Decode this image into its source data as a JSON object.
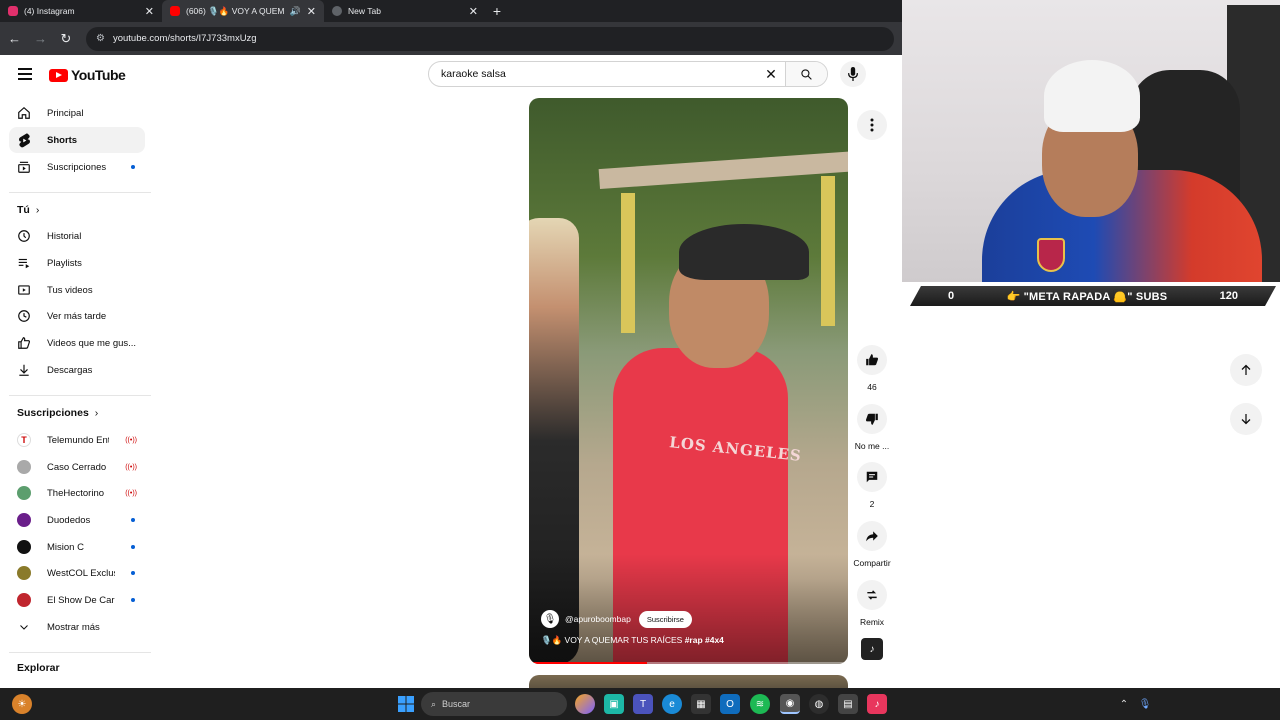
{
  "browser": {
    "tabs": [
      {
        "label": "(4) Instagram",
        "color": "#e1306c",
        "active": false
      },
      {
        "label": "(606) 🎙️🔥 VOY A QUEMAR",
        "color": "#ff0000",
        "active": true
      },
      {
        "label": "New Tab",
        "color": "#9aa0a6",
        "active": false
      }
    ],
    "url": "youtube.com/shorts/I7J733mxUzg"
  },
  "header": {
    "logo_text": "YouTube",
    "search_value": "karaoke salsa"
  },
  "sidebar": {
    "main": [
      {
        "label": "Principal",
        "icon": "home-icon"
      },
      {
        "label": "Shorts",
        "icon": "shorts-icon",
        "active": true
      },
      {
        "label": "Suscripciones",
        "icon": "subscriptions-icon",
        "dot": true
      }
    ],
    "you_heading": "Tú",
    "you": [
      {
        "label": "Historial",
        "icon": "history-icon"
      },
      {
        "label": "Playlists",
        "icon": "playlists-icon"
      },
      {
        "label": "Tus videos",
        "icon": "your-videos-icon"
      },
      {
        "label": "Ver más tarde",
        "icon": "watch-later-icon"
      },
      {
        "label": "Videos que me gus...",
        "icon": "liked-icon"
      },
      {
        "label": "Descargas",
        "icon": "download-icon"
      }
    ],
    "subs_heading": "Suscripciones",
    "subs": [
      {
        "label": "Telemundo Entre...",
        "color": "#ffffff",
        "live": true
      },
      {
        "label": "Caso Cerrado",
        "color": "#a9a9a9",
        "live": true
      },
      {
        "label": "TheHectorino",
        "color": "#5c9e6e",
        "live": true
      },
      {
        "label": "Duodedos",
        "color": "#6a1e8a",
        "live": false
      },
      {
        "label": "Mision C",
        "color": "#111111",
        "live": false
      },
      {
        "label": "WestCOL Exclusi...",
        "color": "#8a7a2a",
        "live": false
      },
      {
        "label": "El Show De Carlo...",
        "color": "#c0262e",
        "live": false
      }
    ],
    "show_more": "Mostrar más",
    "explore_heading": "Explorar"
  },
  "short": {
    "channel": "@apuroboombap",
    "subscribe": "Suscribirse",
    "title_prefix": "🎙️🔥 VOY A QUEMAR TUS RAÍCES",
    "title_tags": "#rap #4x4",
    "shirt_text": "LOS ANGELES",
    "progress_fraction": 0.37
  },
  "actions": {
    "likes": "46",
    "dislike": "No me ...",
    "comments": "2",
    "share": "Compartir",
    "remix": "Remix"
  },
  "overlay": {
    "left_count": "0",
    "goal_text": "👉 \"META RAPADA 🦲\" SUBS",
    "right_count": "120"
  },
  "taskbar": {
    "search_placeholder": "Buscar"
  }
}
